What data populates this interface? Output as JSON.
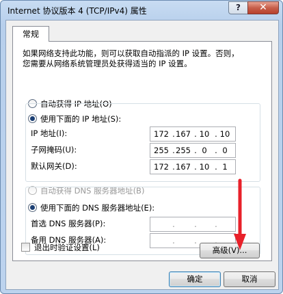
{
  "window": {
    "title": "Internet 协议版本 4 (TCP/IPv4) 属性",
    "help_label": "?",
    "close_label": "✕"
  },
  "tab": {
    "label": "常规"
  },
  "description": {
    "line1": "如果网络支持此功能，则可以获取自动指派的 IP 设置。否则，",
    "line2": "您需要从网络系统管理员处获得适当的 IP 设置。"
  },
  "ip_section": {
    "auto_label": "自动获得 IP 地址(O)",
    "manual_label": "使用下面的 IP 地址(S):",
    "selected": "manual",
    "fields": [
      {
        "label": "IP 地址(I):",
        "octets": [
          "172",
          "167",
          "10",
          "10"
        ]
      },
      {
        "label": "子网掩码(U):",
        "octets": [
          "255",
          "255",
          "0",
          "0"
        ]
      },
      {
        "label": "默认网关(D):",
        "octets": [
          "172",
          "167",
          "10",
          "1"
        ]
      }
    ]
  },
  "dns_section": {
    "auto_label": "自动获得 DNS 服务器地址(B)",
    "manual_label": "使用下面的 DNS 服务器地址(E):",
    "selected": "manual",
    "fields": [
      {
        "label": "首选 DNS 服务器(P):",
        "octets": [
          "",
          "",
          "",
          ""
        ]
      },
      {
        "label": "备用 DNS 服务器(A):",
        "octets": [
          "",
          "",
          "",
          ""
        ]
      }
    ]
  },
  "validate": {
    "label": "退出时验证设置(L)",
    "checked": false
  },
  "buttons": {
    "advanced": "高级(V)...",
    "ok": "确定",
    "cancel": "取消"
  },
  "colors": {
    "annotation_arrow": "#e8212a"
  }
}
